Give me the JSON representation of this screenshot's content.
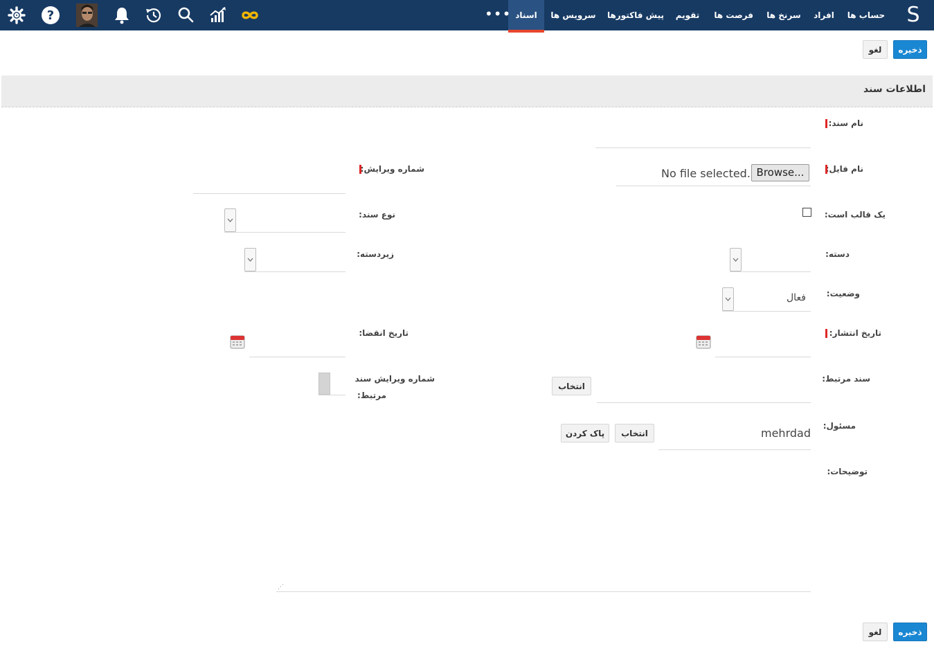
{
  "topbar": {
    "logo": "S",
    "nav": [
      "حساب ها",
      "افراد",
      "سرنخ ها",
      "فرصت ها",
      "تقویم",
      "پیش فاکتورها",
      "سرویس ها",
      "اسناد"
    ],
    "more": "•••",
    "icons": [
      "infinity-icon",
      "chart-icon",
      "search-icon",
      "history-icon",
      "bell-icon",
      "avatar",
      "help-icon",
      "settings-icon"
    ]
  },
  "toolbar": {
    "save": "ذخیره",
    "cancel": "لغو"
  },
  "section": {
    "title": "اطلاعات سند"
  },
  "form": {
    "doc_name": {
      "label": "نام سند:",
      "value": ""
    },
    "file_name": {
      "label": "نام فایل:",
      "browse": "Browse...",
      "status": "No file selected."
    },
    "revision_no": {
      "label": "شماره ویرایش:",
      "value": ""
    },
    "is_template": {
      "label": "یک قالب است:",
      "checked": false
    },
    "doc_type": {
      "label": "نوع سند:",
      "value": ""
    },
    "category": {
      "label": "دسته:",
      "value": ""
    },
    "subcategory": {
      "label": "زیردسته:",
      "value": ""
    },
    "status": {
      "label": "وضعیت:",
      "value": "فعال"
    },
    "publish_date": {
      "label": "تاریخ انتشار:",
      "value": ""
    },
    "expire_date": {
      "label": "تاریخ انقضا:",
      "value": ""
    },
    "related_doc": {
      "label": "سند مرتبط:",
      "select": "انتخاب"
    },
    "related_revision": {
      "label_line1": "شماره ویرایش سند",
      "label_line2": "مرتبط:"
    },
    "owner": {
      "label": "مسئول:",
      "value": "mehrdad",
      "select": "انتخاب",
      "clear": "پاک کردن"
    },
    "description": {
      "label": "توضیحات:",
      "value": ""
    }
  },
  "colors": {
    "topbar": "#173a63",
    "primary": "#1a87d3",
    "active_tab_marker": "#e8452d",
    "required": "#e02626"
  }
}
